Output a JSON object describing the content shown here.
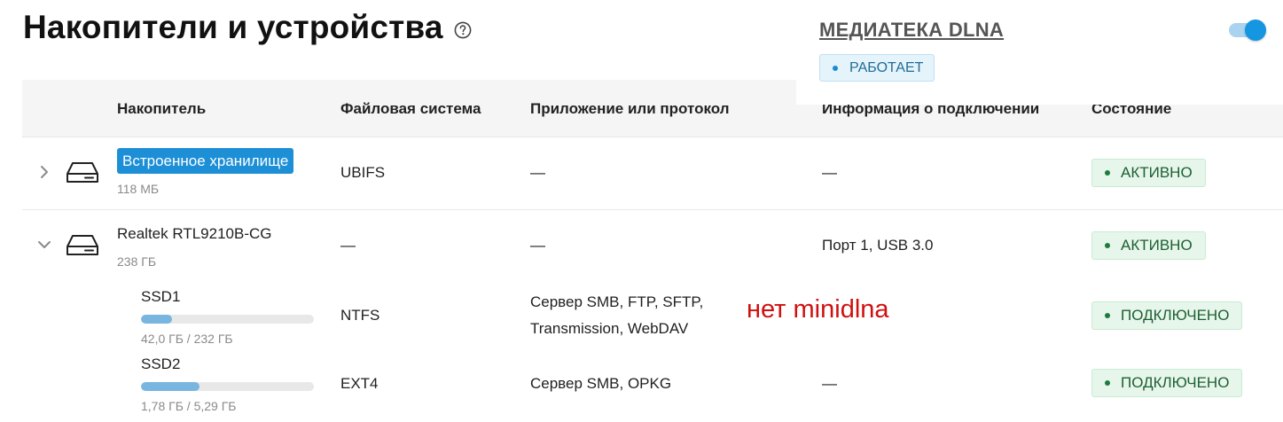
{
  "header": {
    "title": "Накопители и устройства"
  },
  "dlna": {
    "title": "МЕДИАТЕКА DLNA",
    "status": "РАБОТАЕТ",
    "enabled": true,
    "status_color": "#1e8ad0"
  },
  "table": {
    "columns": [
      "Накопитель",
      "Файловая система",
      "Приложение или протокол",
      "Информация о подключении",
      "Состояние"
    ],
    "devices": [
      {
        "name": "Встроенное хранилище",
        "size": "118 МБ",
        "fs": "UBIFS",
        "app": "—",
        "info": "—",
        "state": "АКТИВНО",
        "expanded": false
      },
      {
        "name": "Realtek RTL9210B-CG",
        "size": "238 ГБ",
        "fs": "—",
        "app": "—",
        "info": "Порт 1, USB 3.0",
        "state": "АКТИВНО",
        "expanded": true
      }
    ],
    "partitions": [
      {
        "name": "SSD1",
        "usage": "42,0 ГБ / 232 ГБ",
        "fill_fraction": 0.18,
        "fs": "NTFS",
        "app_line1": "Сервер SMB, FTP, SFTP,",
        "app_line2": "Transmission, WebDAV",
        "info": "",
        "state": "ПОДКЛЮЧЕНО"
      },
      {
        "name": "SSD2",
        "usage": "1,78 ГБ / 5,29 ГБ",
        "fill_fraction": 0.34,
        "fs": "EXT4",
        "app": "Сервер SMB, OPKG",
        "info": "—",
        "state": "ПОДКЛЮЧЕНО"
      }
    ]
  },
  "annotation": {
    "text": "нет minidlna",
    "color": "#d01010"
  },
  "colors": {
    "accent": "#1d8fd6",
    "active_green": "#1f7a3e",
    "usage_bar": "#78b6e0"
  },
  "icons": [
    "help-icon",
    "chevron-right-icon",
    "chevron-down-icon",
    "hard-drive-icon"
  ]
}
